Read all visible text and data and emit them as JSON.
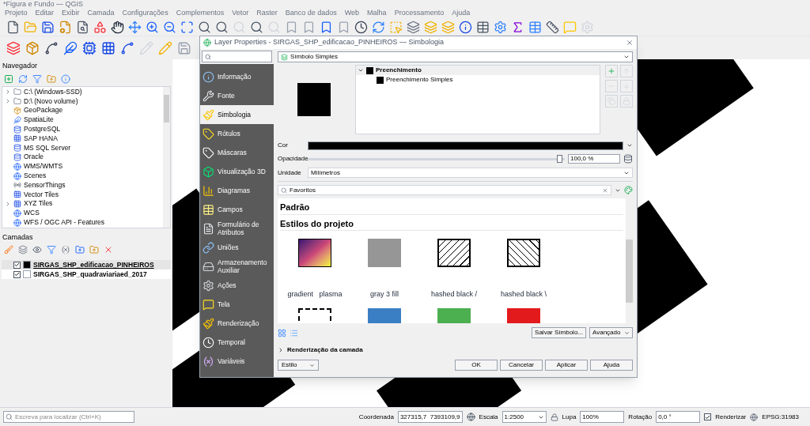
{
  "window": {
    "title": "*Figura e Fundo — QGIS"
  },
  "menu": [
    "Projeto",
    "Editar",
    "Exibir",
    "Camada",
    "Configurações",
    "Complementos",
    "Vetor",
    "Raster",
    "Banco de dados",
    "Web",
    "Malha",
    "Processamento",
    "Ajuda"
  ],
  "browser": {
    "title": "Navegador",
    "items": [
      {
        "label": "C:\\ (Windows-SSD)",
        "kind": "folder",
        "expandable": true
      },
      {
        "label": "D:\\ (Novo volume)",
        "kind": "folder",
        "expandable": true
      },
      {
        "label": "GeoPackage",
        "kind": "package",
        "expandable": false
      },
      {
        "label": "SpatiaLite",
        "kind": "feather",
        "expandable": false
      },
      {
        "label": "PostgreSQL",
        "kind": "database",
        "expandable": false
      },
      {
        "label": "SAP HANA",
        "kind": "grid",
        "expandable": false
      },
      {
        "label": "MS SQL Server",
        "kind": "database",
        "expandable": false
      },
      {
        "label": "Oracle",
        "kind": "database",
        "expandable": false
      },
      {
        "label": "WMS/WMTS",
        "kind": "globe",
        "expandable": false
      },
      {
        "label": "Scenes",
        "kind": "globe",
        "expandable": false
      },
      {
        "label": "SensorThings",
        "kind": "radio",
        "expandable": false
      },
      {
        "label": "Vector Tiles",
        "kind": "grid",
        "expandable": false
      },
      {
        "label": "XYZ Tiles",
        "kind": "grid",
        "expandable": true
      },
      {
        "label": "WCS",
        "kind": "globe",
        "expandable": false
      },
      {
        "label": "WFS / OGC API - Features",
        "kind": "globe",
        "expandable": false
      }
    ]
  },
  "layers_panel": {
    "title": "Camadas",
    "layers": [
      {
        "name": "SIRGAS_SHP_edificacao_PINHEIROS",
        "checked": true,
        "color": "#000000",
        "selected": true
      },
      {
        "name": "SIRGAS_SHP_quadraviariaed_2017",
        "checked": true,
        "color": "#ffffff",
        "selected": false
      }
    ]
  },
  "dialog": {
    "title": "Layer Properties - SIRGAS_SHP_edificacao_PINHEIROS — Simbologia",
    "sections": [
      {
        "label": "Informação",
        "kind": "info",
        "selected": false
      },
      {
        "label": "Fonte",
        "kind": "wrench",
        "selected": false
      },
      {
        "label": "Simbologia",
        "kind": "brush",
        "selected": true
      },
      {
        "label": "Rótulos",
        "kind": "tag",
        "selected": false
      },
      {
        "label": "Máscaras",
        "kind": "mask",
        "selected": false
      },
      {
        "label": "Visualização 3D",
        "kind": "cube",
        "selected": false
      },
      {
        "label": "Diagramas",
        "kind": "chart",
        "selected": false
      },
      {
        "label": "Campos",
        "kind": "table",
        "selected": false
      },
      {
        "label": "Formulário de Atributos",
        "kind": "form",
        "selected": false
      },
      {
        "label": "Uniões",
        "kind": "join",
        "selected": false
      },
      {
        "label": "Armazenamento Auxiliar",
        "kind": "storage",
        "selected": false
      },
      {
        "label": "Ações",
        "kind": "gear",
        "selected": false
      },
      {
        "label": "Tela",
        "kind": "message",
        "selected": false
      },
      {
        "label": "Renderização",
        "kind": "brush",
        "selected": false
      },
      {
        "label": "Temporal",
        "kind": "clock",
        "selected": false
      },
      {
        "label": "Variáveis",
        "kind": "variable",
        "selected": false
      }
    ],
    "renderer": "Símbolo Simples",
    "symbol_tree": {
      "label": "Preenchimento",
      "expanded": true,
      "children": [
        {
          "label": "Preenchimento Simples"
        }
      ]
    },
    "color": {
      "label": "Cor"
    },
    "opacity": {
      "label": "Opacidade",
      "level": 0.99,
      "reading": "100,0 %"
    },
    "unit": {
      "label": "Unidade",
      "value": "Milímetros"
    },
    "style_search": {
      "value": "Favoritos"
    },
    "groups": [
      "Padrão",
      "Estilos do projeto"
    ],
    "styles": [
      {
        "label": "gradient   plasma",
        "kind": "gradient"
      },
      {
        "label": "gray 3 fill",
        "kind": "solid",
        "color": "#969696"
      },
      {
        "label": "hashed black /",
        "kind": "hatch-forward"
      },
      {
        "label": "hashed black \\",
        "kind": "hatch-back"
      },
      {
        "kind": "dashed"
      },
      {
        "kind": "solid",
        "color": "#3a7fc4"
      },
      {
        "kind": "solid",
        "color": "#4caf50"
      },
      {
        "kind": "solid",
        "color": "#e31a1c"
      }
    ],
    "save_symbol": "Salvar Símbolo...",
    "advanced": "Avançado",
    "layer_rendering": {
      "label": "Renderização da camada",
      "expanded": false
    },
    "style_button": "Estilo",
    "buttons": [
      "OK",
      "Cancelar",
      "Aplicar",
      "Ajuda"
    ]
  },
  "status_bar": {
    "search_placeholder": "Escreva para localizar (Ctrl+K)",
    "coordinate_label": "Coordenada",
    "coordinate": "327315,7  7393109,9",
    "scale_label": "Escala",
    "scale": "1:2500",
    "magnifier_label": "Lupa",
    "magnifier": "100%",
    "rotation_label": "Rotação",
    "rotation": "0,0 °",
    "render_label": "Renderizar",
    "render_checked": true,
    "crs": "EPSG:31983"
  }
}
